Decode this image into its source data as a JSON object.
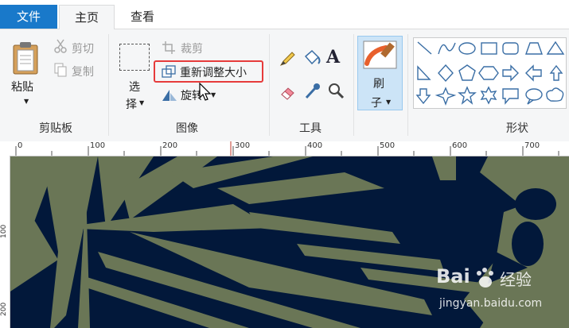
{
  "tabs": {
    "file": "文件",
    "home": "主页",
    "view": "查看"
  },
  "clipboard": {
    "paste": "粘贴",
    "cut": "剪切",
    "copy": "复制",
    "label": "剪贴板"
  },
  "image": {
    "select_line1": "选",
    "select_line2": "择",
    "crop": "裁剪",
    "resize": "重新调整大小",
    "rotate": "旋转",
    "label": "图像"
  },
  "tools": {
    "label": "工具"
  },
  "brush": {
    "line1": "刷",
    "line2": "子"
  },
  "shapes": {
    "label": "形状"
  },
  "ruler": {
    "ticks": [
      "0",
      "100",
      "200",
      "300",
      "400",
      "500",
      "600",
      "700"
    ],
    "vticks": [
      "100",
      "200"
    ]
  },
  "watermark": {
    "brand": "Bai",
    "brand2": "经验",
    "url": "jingyan.baidu.com"
  },
  "colors": {
    "accent": "#1979ca",
    "highlight": "#e63b3b",
    "canvas_bg": "#02183a",
    "leaf": "#6a7656"
  }
}
